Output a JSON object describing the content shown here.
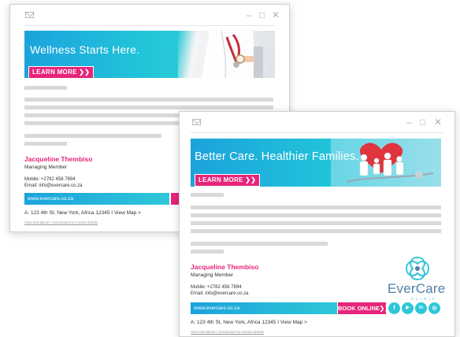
{
  "window1": {
    "controls": {
      "minimize": "–",
      "maximize": "□",
      "close": "✕"
    },
    "banner_title": "Wellness Starts Here.",
    "learn_more": "LEARN MORE ❯❯",
    "name": "Jacqueline Thembiso",
    "role": "Managing Member",
    "mobile": "Mobile: +2782 456 7894",
    "email": "Email: info@evercare.co.za",
    "website": "www.evercare.co.za",
    "address": "A: 123 4th St, New York, Africa 12345  I  View Map >",
    "links": "View Disclaimer  |  Download my contact details"
  },
  "window2": {
    "controls": {
      "minimize": "–",
      "maximize": "□",
      "close": "✕"
    },
    "banner_title": "Better Care. Healthier Families.",
    "learn_more": "LEARN MORE ❯❯",
    "name": "Jacqueline Thembiso",
    "role": "Managing Member",
    "mobile": "Mobile: +2782 456 7894",
    "email": "Email: info@evercare.co.za",
    "website": "www.evercare.co.za",
    "book_online": "BOOK ONLINE❯❯",
    "address": "A: 123 4th St, New York, Africa 12345  I  View Map >",
    "links": "View Disclaimer  |  Download my contact details",
    "logo": {
      "name": "EverCare",
      "sub": "CLINIC"
    },
    "social": [
      {
        "icon": "facebook-icon",
        "glyph": "f"
      },
      {
        "icon": "youtube-icon",
        "glyph": "▶"
      },
      {
        "icon": "linkedin-icon",
        "glyph": "in"
      },
      {
        "icon": "instagram-icon",
        "glyph": "◎"
      }
    ]
  },
  "colors": {
    "accent_pink": "#e6257a",
    "accent_teal": "#2fc7d8",
    "brand_blue": "#1ba3dc"
  }
}
